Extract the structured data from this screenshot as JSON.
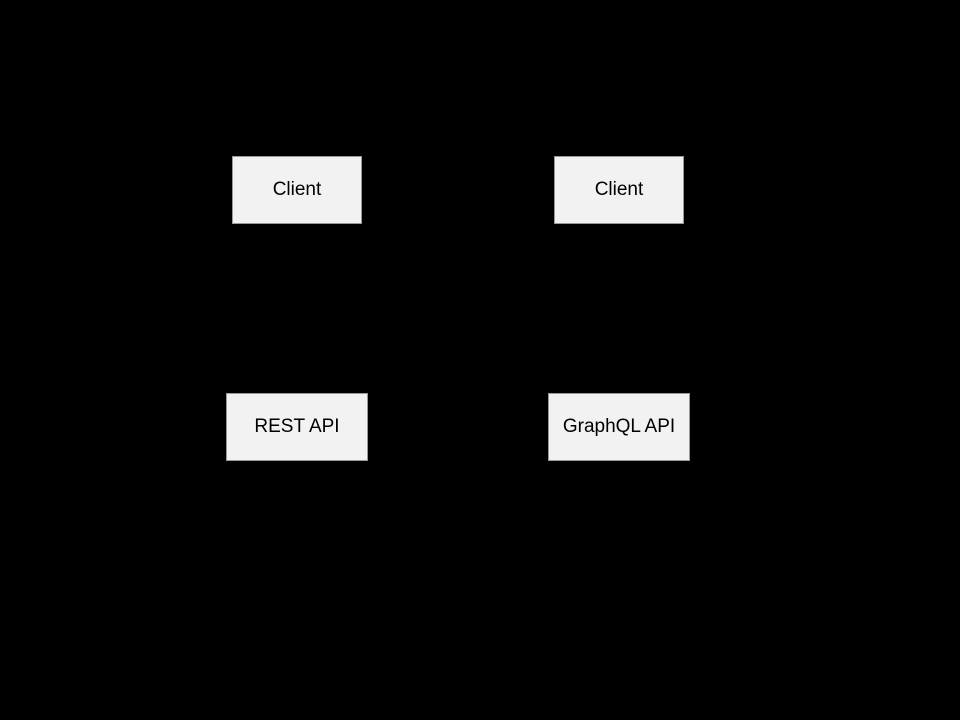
{
  "diagram": {
    "client_left": "Client",
    "client_right": "Client",
    "rest_api": "REST API",
    "graphql_api": "GraphQL API"
  }
}
